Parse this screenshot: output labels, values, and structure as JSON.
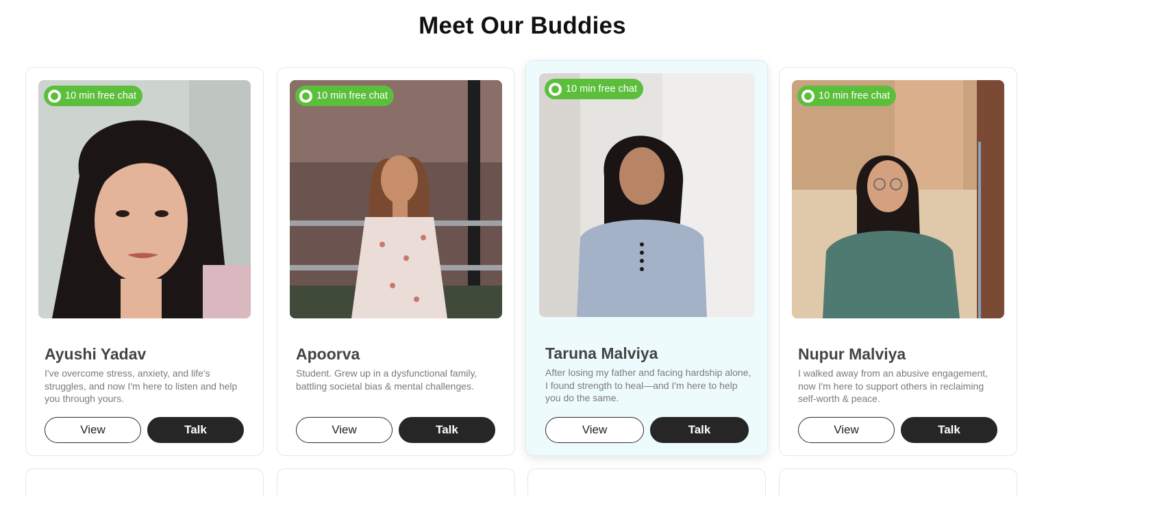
{
  "section": {
    "title": "Meet Our Buddies"
  },
  "badge_label": "10 min free chat",
  "buttons": {
    "view_label": "View",
    "talk_label": "Talk"
  },
  "colors": {
    "badge_green": "#5cbf3c",
    "talk_button": "#262626",
    "highlight_card_bg": "#eefbfc",
    "name_text": "#444444",
    "bio_text": "#7a7a7a"
  },
  "buddies": [
    {
      "name": "Ayushi Yadav",
      "bio": "I've overcome stress, anxiety, and life's struggles, and now I'm here to listen and help you through yours."
    },
    {
      "name": "Apoorva",
      "bio": "Student. Grew up in a dysfunctional family, battling societal bias & mental challenges."
    },
    {
      "name": "Taruna Malviya",
      "bio": "After losing my father and facing hardship alone, I found strength to heal—and I'm here to help you do the same.",
      "highlighted": true
    },
    {
      "name": "Nupur Malviya",
      "bio": "I walked away from an abusive engagement, now I'm here to support others in reclaiming self-worth & peace."
    }
  ]
}
